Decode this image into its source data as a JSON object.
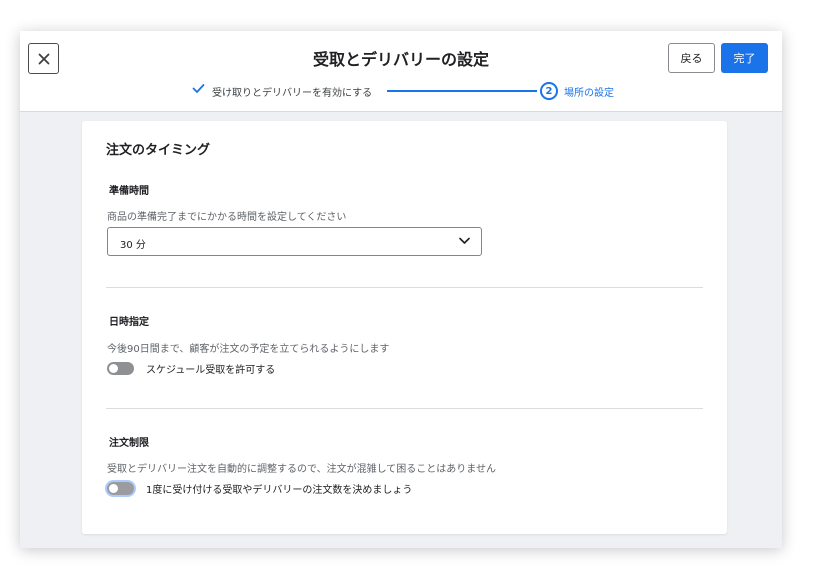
{
  "header": {
    "title": "受取とデリバリーの設定",
    "back_label": "戻る",
    "done_label": "完了"
  },
  "steps": {
    "step1_label": "受け取りとデリバリーを有効にする",
    "step2_number": "2",
    "step2_label": "場所の設定"
  },
  "card": {
    "title": "注文のタイミング",
    "prep_time": {
      "title": "準備時間",
      "description": "商品の準備完了までにかかる時間を設定してください",
      "selected_value": "30 分"
    },
    "scheduling": {
      "title": "日時指定",
      "description": "今後90日間まで、顧客が注文の予定を立てられるようにします",
      "toggle_label": "スケジュール受取を許可する",
      "toggle_on": false
    },
    "order_limit": {
      "title": "注文制限",
      "description": "受取とデリバリー注文を自動的に調整するので、注文が混雑して困ることはありません",
      "toggle_label": "1度に受け付ける受取やデリバリーの注文数を決めましょう",
      "toggle_on": false
    }
  },
  "colors": {
    "accent": "#1a73e8",
    "background": "#eff0f3",
    "toggle_off": "#8e9094"
  }
}
